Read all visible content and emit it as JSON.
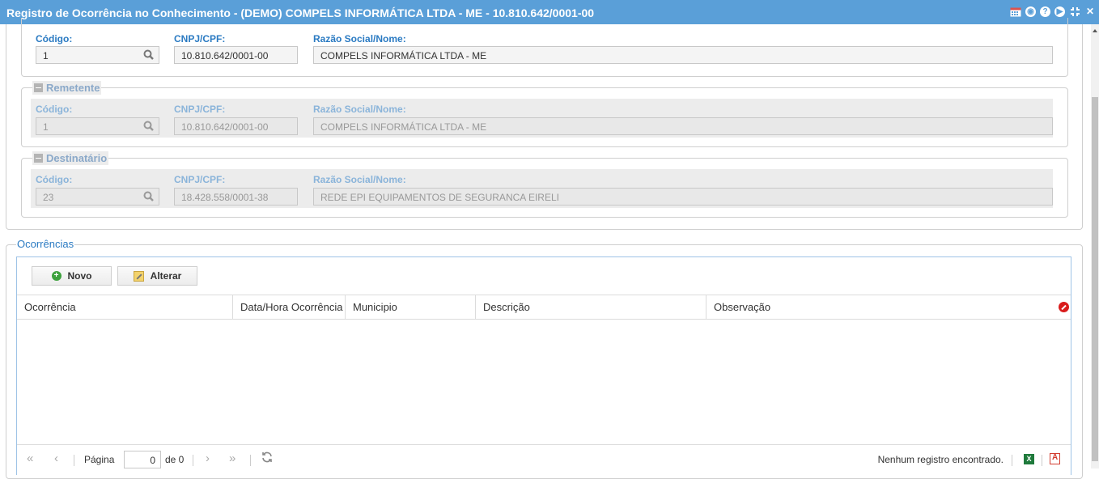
{
  "window": {
    "title": "Registro de Ocorrência no Conhecimento - (DEMO) COMPELS INFORMÁTICA LTDA - ME - 10.810.642/0001-00",
    "icons": [
      "calendar-icon",
      "chat-icon",
      "help-icon",
      "play-icon",
      "shrink-icon",
      "close-icon"
    ]
  },
  "tomador": {
    "codigo_label": "Código:",
    "codigo_value": "1",
    "cnpj_label": "CNPJ/CPF:",
    "cnpj_value": "10.810.642/0001-00",
    "razao_label": "Razão Social/Nome:",
    "razao_value": "COMPELS INFORMÁTICA LTDA - ME"
  },
  "remetente": {
    "legend": "Remetente",
    "codigo_label": "Código:",
    "codigo_value": "1",
    "cnpj_label": "CNPJ/CPF:",
    "cnpj_value": "10.810.642/0001-00",
    "razao_label": "Razão Social/Nome:",
    "razao_value": "COMPELS INFORMÁTICA LTDA - ME"
  },
  "destinatario": {
    "legend": "Destinatário",
    "codigo_label": "Código:",
    "codigo_value": "23",
    "cnpj_label": "CNPJ/CPF:",
    "cnpj_value": "18.428.558/0001-38",
    "razao_label": "Razão Social/Nome:",
    "razao_value": "REDE EPI EQUIPAMENTOS DE SEGURANCA EIRELI"
  },
  "ocorrencias": {
    "legend": "Ocorrências",
    "toolbar": {
      "novo_label": "Novo",
      "alterar_label": "Alterar"
    },
    "columns": [
      "Ocorrência",
      "Data/Hora Ocorrência",
      "Municipio",
      "Descrição",
      "Observação"
    ],
    "rows": [],
    "pager": {
      "page_label": "Página",
      "page_value": "0",
      "of_label": "de 0",
      "status": "Nenhum registro encontrado."
    }
  }
}
